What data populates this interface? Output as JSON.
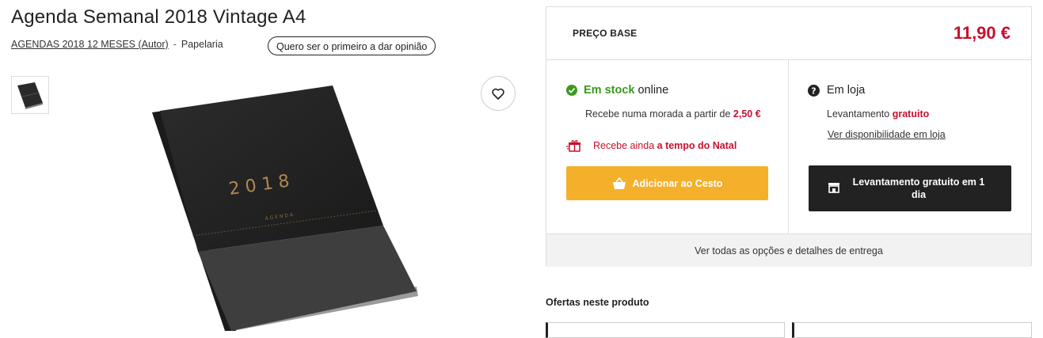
{
  "product": {
    "title": "Agenda Semanal 2018 Vintage A4",
    "author": "AGENDAS 2018 12 MESES (Autor)",
    "separator": "-",
    "category": "Papelaria",
    "review_button": "Quero ser o primeiro a dar opinião",
    "cover_year": "2 0 1 8",
    "cover_word": "AGENDA"
  },
  "purchase": {
    "price_label": "PREÇO BASE",
    "price": "11,90 €",
    "online": {
      "stock_status": "Em stock",
      "stock_suffix": "online",
      "shipping_prefix": "Recebe numa morada a partir de",
      "shipping_price": "2,50 €",
      "christmas_prefix": "Recebe ainda",
      "christmas_highlight": "a tempo do Natal",
      "add_button": "Adicionar ao Cesto"
    },
    "store": {
      "label": "Em loja",
      "pickup_prefix": "Levantamento",
      "pickup_highlight": "gratuito",
      "availability_link": "Ver disponibilidade em loja",
      "pickup_button": "Levantamento gratuito em 1 dia"
    },
    "all_options": "Ver todas as opções e detalhes de entrega"
  },
  "offers": {
    "title": "Ofertas neste produto"
  },
  "colors": {
    "price_red": "#c8102e",
    "stock_green": "#3a9a1d",
    "cart_yellow": "#f4b02a",
    "dark_button": "#222222"
  }
}
